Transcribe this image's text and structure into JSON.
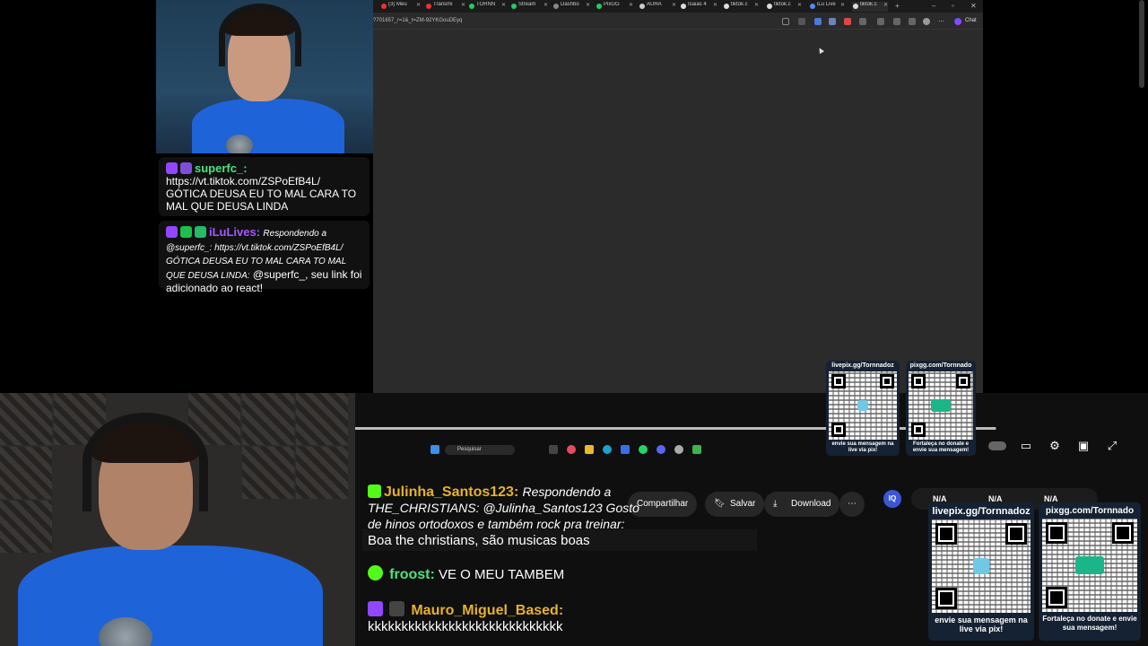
{
  "browser": {
    "tabs": [
      {
        "label": "(3) Meu",
        "color": "#e33"
      },
      {
        "label": "Transmi",
        "color": "#e33"
      },
      {
        "label": "TORNN",
        "color": "#2c6"
      },
      {
        "label": "Stream",
        "color": "#2c6"
      },
      {
        "label": "Dashbo",
        "color": "#888"
      },
      {
        "label": "PixGG",
        "color": "#2c6"
      },
      {
        "label": "AURA",
        "color": "#ccc"
      },
      {
        "label": "Isaias 4",
        "color": "#ddd"
      },
      {
        "label": "tiktok.c",
        "color": "#ddd"
      },
      {
        "label": "tiktok.c",
        "color": "#ddd"
      },
      {
        "label": "iLu Live",
        "color": "#58f"
      },
      {
        "label": "tiktok.c",
        "color": "#ddd"
      }
    ],
    "url": "?701657_r=1&_t=ZM-92YKGouDEyq",
    "chat_label": "Chat"
  },
  "top_chat": [
    {
      "user": "superfc_:",
      "user_color": "#4ae37c",
      "text": "https://vt.tiktok.com/ZSPoEfB4L/ GÓTICA DEUSA EU TO MAL CARA TO MAL QUE DEUSA LINDA"
    },
    {
      "user": "iLuLives:",
      "user_color": "#a259ff",
      "reply": "Respondendo a @superfc_: https://vt.tiktok.com/ZSPoEfB4L/ GÓTICA DEUSA EU TO MAL CARA TO MAL QUE DEUSA LINDA:",
      "text": "@superfc_, seu link foi adicionado ao react!"
    }
  ],
  "video": {
    "progress": 0.999,
    "taskbar_search": "Pesquisar"
  },
  "yt_actions": {
    "share": "Compartilhar",
    "save": "Salvar",
    "download": "Download",
    "na_values": [
      "N/A",
      "N/A",
      "N/A"
    ]
  },
  "bottom_chat": [
    {
      "user": "Julinha_Santos123:",
      "user_color": "#e6b12e",
      "reply": "Respondendo a THE_CHRISTIANS: @Julinha_Santos123 Gosto de hinos ortodoxos e também rock pra treinar:",
      "text": "Boa the christians, são musicas boas"
    },
    {
      "user": "froost:",
      "user_color": "#4ae37c",
      "text": "VE O MEU TAMBEM"
    },
    {
      "user": "Mauro_Miguel_Based:",
      "user_color": "#e6b12e",
      "text": "kkkkkkkkkkkkkkkkkkkkkkkkkkkkk"
    }
  ],
  "qr_small": [
    {
      "top": "livepix.gg/Tornnadoz",
      "bottom": "envie sua mensagem na live via pix!"
    },
    {
      "top": "pixgg.com/Tornnado",
      "bottom": "Fortaleça no donate e envie sua mensagem!"
    }
  ],
  "qr_large": [
    {
      "top": "livepix.gg/Tornnadoz",
      "bottom": "envie sua mensagem na live via pix!"
    },
    {
      "top": "pixgg.com/Tornnado",
      "bottom": "Fortaleça no donate e envie sua mensagem!"
    }
  ]
}
